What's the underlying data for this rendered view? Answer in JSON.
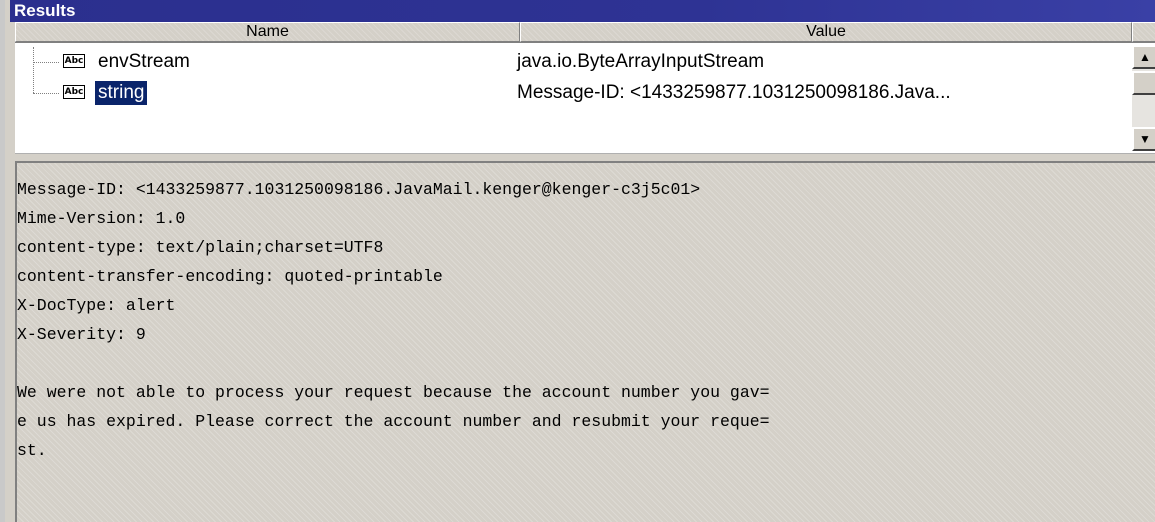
{
  "panel": {
    "title": "Results"
  },
  "table": {
    "columns": [
      "Name",
      "Value"
    ],
    "rows": [
      {
        "icon": "abc-string-icon",
        "name": "envStream",
        "value": "java.io.ByteArrayInputStream"
      },
      {
        "icon": "abc-string-icon",
        "name": "string",
        "value": "Message-ID: <1433259877.1031250098186.Java...",
        "selected": true
      }
    ],
    "icon_label": "Abc"
  },
  "scrollbar": {
    "up": "▲",
    "down": "▼"
  },
  "message": {
    "lines": [
      "Message-ID: <1433259877.1031250098186.JavaMail.kenger@kenger-c3j5c01>",
      "Mime-Version: 1.0",
      "content-type: text/plain;charset=UTF8",
      "content-transfer-encoding: quoted-printable",
      "X-DocType: alert",
      "X-Severity: 9",
      "",
      "We were not able to process your request because the account number you gav=",
      "e us has expired. Please correct the account number and resubmit your reque=",
      "st."
    ]
  },
  "colors": {
    "title_bg": "#2e3394",
    "selection_bg": "#0a246a",
    "panel_bg": "#d4d0c8"
  }
}
